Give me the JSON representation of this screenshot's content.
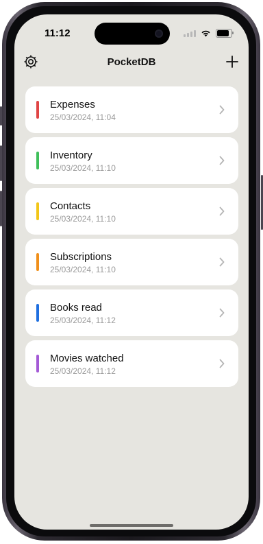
{
  "status": {
    "time": "11:12"
  },
  "nav": {
    "title": "PocketDB",
    "settings_icon": "gear-icon",
    "add_icon": "plus-icon"
  },
  "databases": [
    {
      "name": "Expenses",
      "date": "25/03/2024, 11:04",
      "color": "#e04545"
    },
    {
      "name": "Inventory",
      "date": "25/03/2024, 11:10",
      "color": "#3fbf5a"
    },
    {
      "name": "Contacts",
      "date": "25/03/2024, 11:10",
      "color": "#f2c618"
    },
    {
      "name": "Subscriptions",
      "date": "25/03/2024, 11:10",
      "color": "#f08f1a"
    },
    {
      "name": "Books read",
      "date": "25/03/2024, 11:12",
      "color": "#1f6fe0"
    },
    {
      "name": "Movies watched",
      "date": "25/03/2024, 11:12",
      "color": "#a45ad6"
    }
  ],
  "colors": {
    "background": "#e6e5e0",
    "card": "#ffffff",
    "chevron": "#b5b5b5"
  }
}
